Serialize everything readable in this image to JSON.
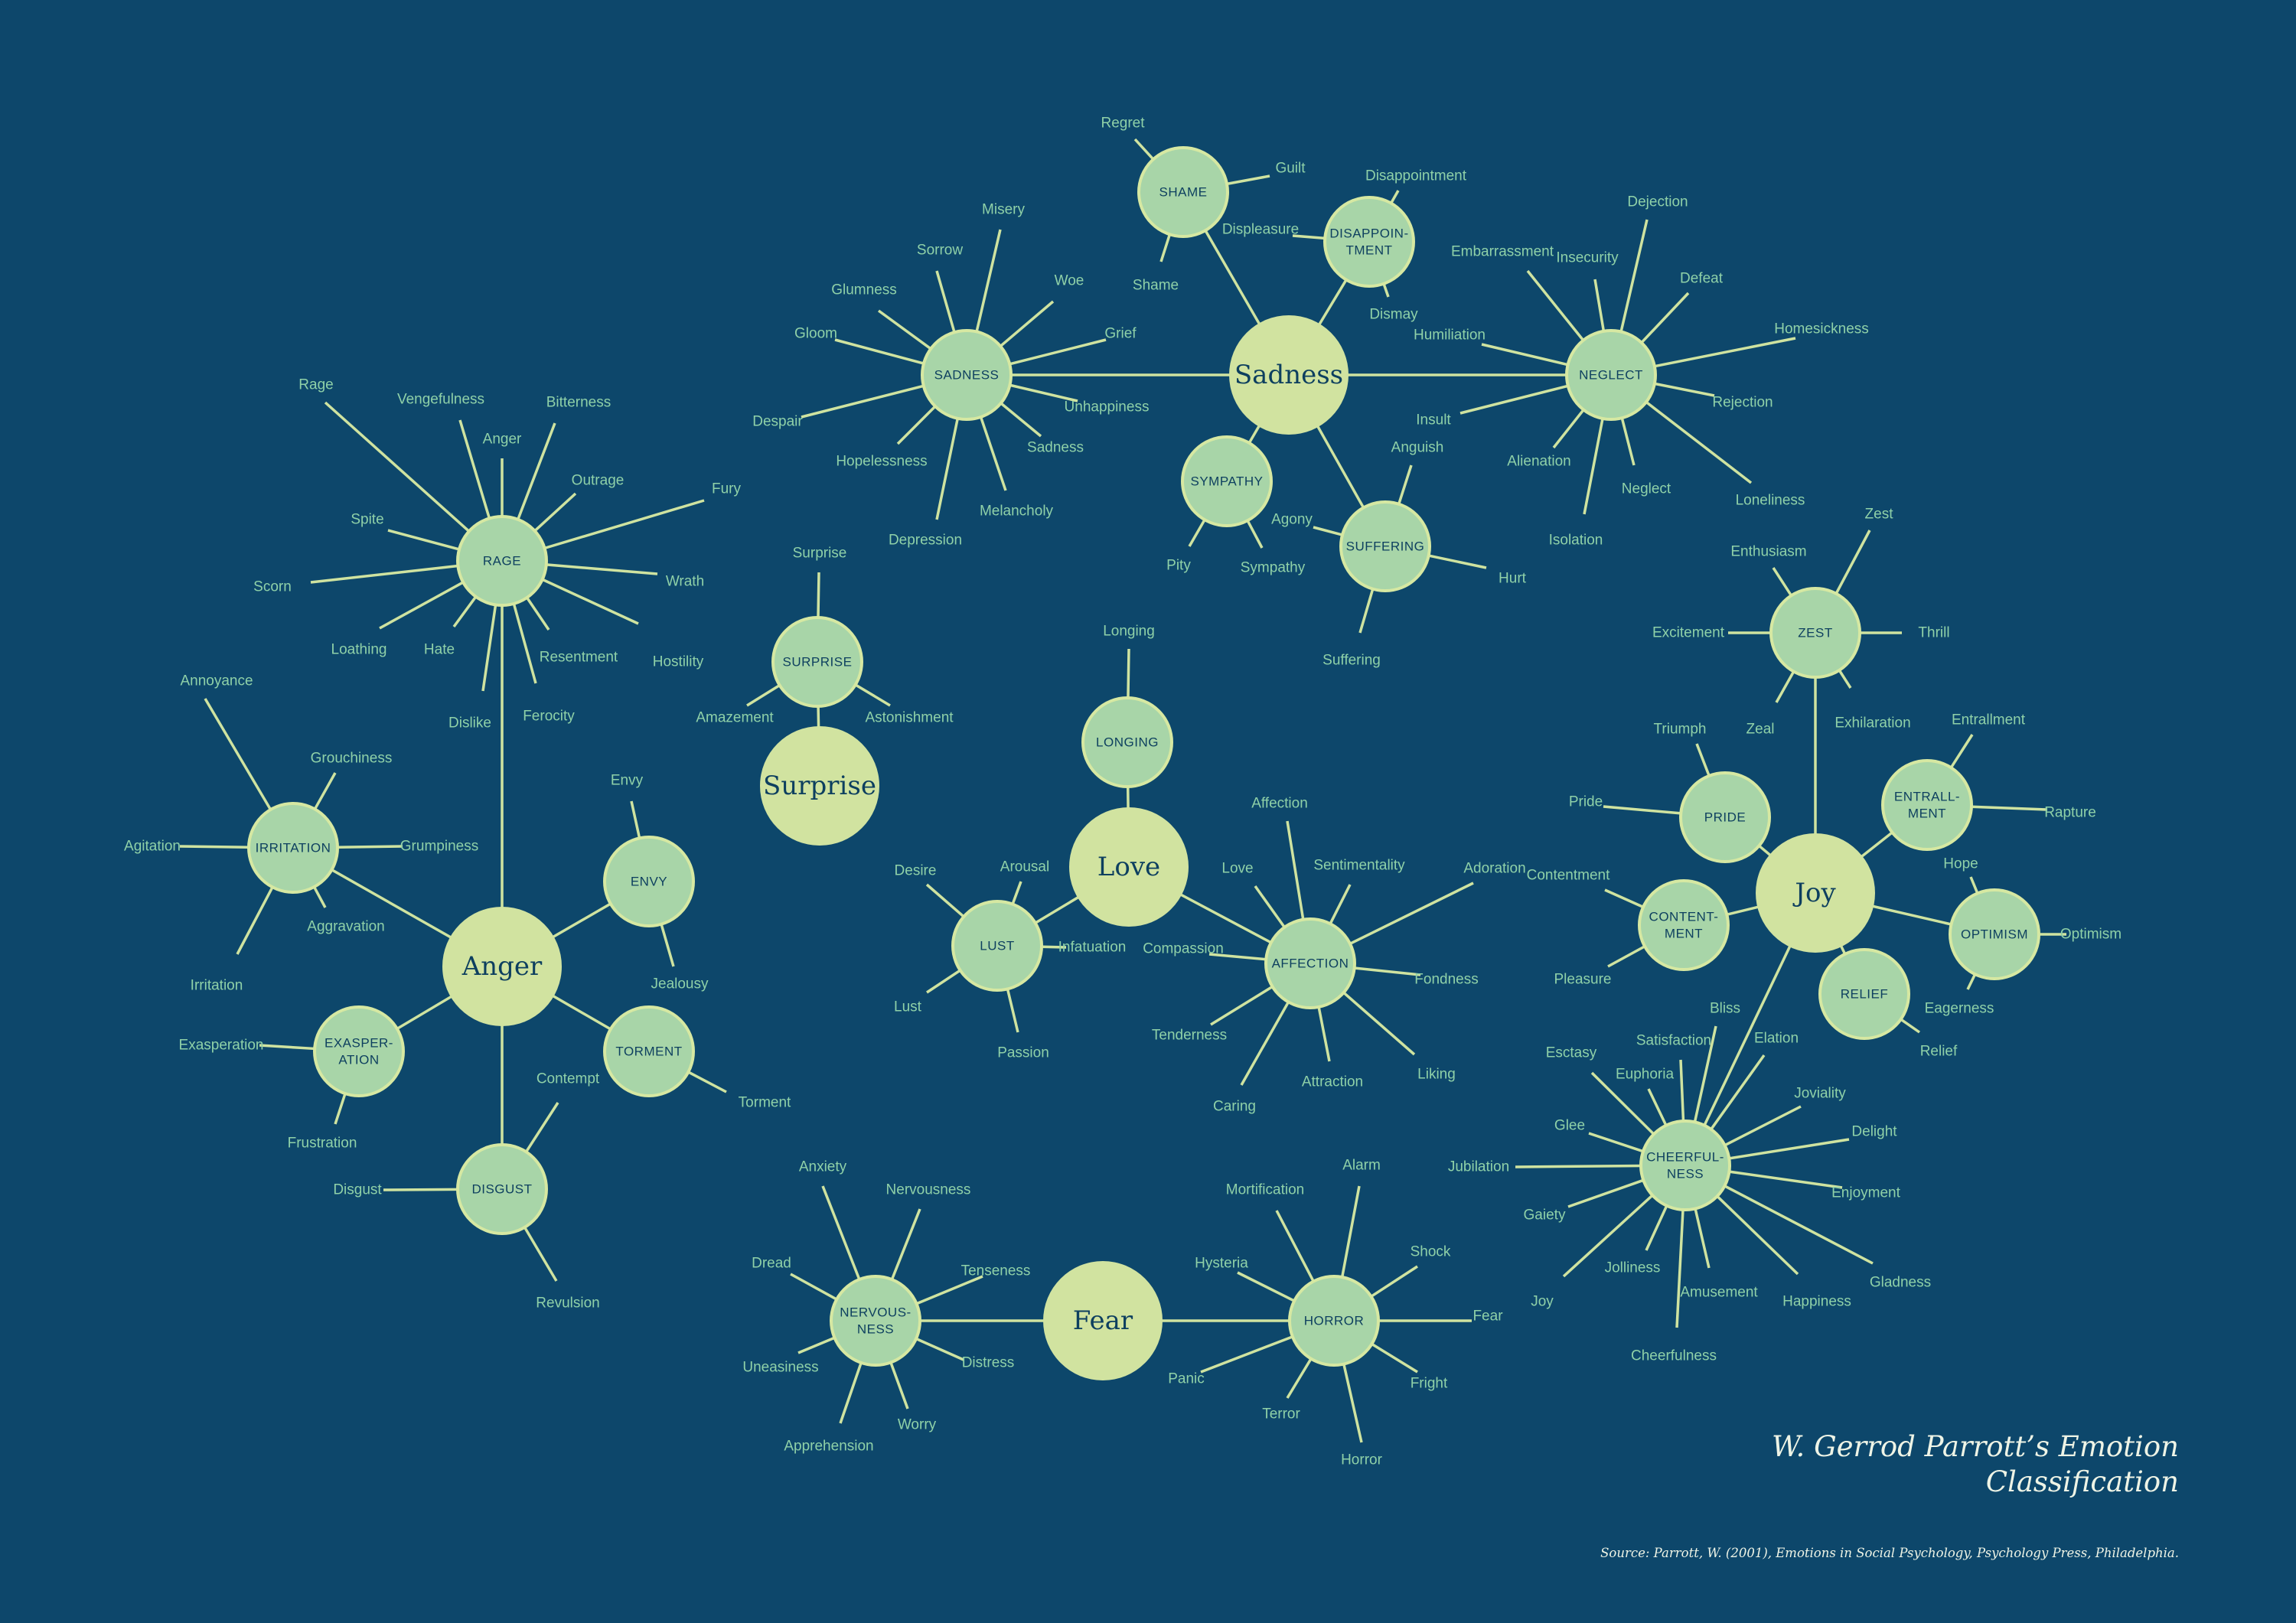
{
  "title": {
    "line1": "W. Gerrod Parrott’s Emotion",
    "line2": "Classification"
  },
  "source": "Source: Parrott, W. (2001), Emotions in Social Psychology, Psychology Press, Philadelphia.",
  "colors": {
    "background": "#0d476b",
    "primary_node": "#d1e3a0",
    "secondary_node": "#a8d5a8",
    "leaf_text": "#8fd1a8",
    "node_text": "#0d3f5f",
    "edge": "#cfe3a0"
  },
  "primary": [
    {
      "id": "anger",
      "label": "Anger"
    },
    {
      "id": "sadness",
      "label": "Sadness"
    },
    {
      "id": "surprise",
      "label": "Surprise"
    },
    {
      "id": "love",
      "label": "Love"
    },
    {
      "id": "fear",
      "label": "Fear"
    },
    {
      "id": "joy",
      "label": "Joy"
    }
  ],
  "secondary": [
    {
      "id": "rage",
      "parent": "anger",
      "label": [
        "RAGE"
      ],
      "leaves": [
        "Rage",
        "Vengefulness",
        "Anger",
        "Bitterness",
        "Outrage",
        "Fury",
        "Spite",
        "Scorn",
        "Wrath",
        "Loathing",
        "Hate",
        "Resentment",
        "Hostility",
        "Dislike",
        "Ferocity"
      ]
    },
    {
      "id": "irritation",
      "parent": "anger",
      "label": [
        "IRRITATION"
      ],
      "leaves": [
        "Annoyance",
        "Grouchiness",
        "Agitation",
        "Grumpiness",
        "Aggravation",
        "Irritation"
      ]
    },
    {
      "id": "envy",
      "parent": "anger",
      "label": [
        "ENVY"
      ],
      "leaves": [
        "Envy",
        "Jealousy"
      ]
    },
    {
      "id": "exasperation",
      "parent": "anger",
      "label": [
        "EXASPER-",
        "ATION"
      ],
      "leaves": [
        "Exasperation",
        "Frustration"
      ]
    },
    {
      "id": "torment",
      "parent": "anger",
      "label": [
        "TORMENT"
      ],
      "leaves": [
        "Torment"
      ]
    },
    {
      "id": "disgust",
      "parent": "anger",
      "label": [
        "DISGUST"
      ],
      "leaves": [
        "Contempt",
        "Disgust",
        "Revulsion"
      ]
    },
    {
      "id": "sadness2",
      "parent": "sadness",
      "label": [
        "SADNESS"
      ],
      "leaves": [
        "Misery",
        "Sorrow",
        "Glumness",
        "Woe",
        "Gloom",
        "Grief",
        "Unhappiness",
        "Despair",
        "Hopelessness",
        "Sadness",
        "Melancholy",
        "Depression"
      ]
    },
    {
      "id": "shame",
      "parent": "sadness",
      "label": [
        "SHAME"
      ],
      "leaves": [
        "Regret",
        "Guilt",
        "Shame"
      ]
    },
    {
      "id": "disappointment",
      "parent": "sadness",
      "label": [
        "DISAPPOIN-",
        "TMENT"
      ],
      "leaves": [
        "Disappointment",
        "Displeasure",
        "Dismay"
      ]
    },
    {
      "id": "sympathy",
      "parent": "sadness",
      "label": [
        "SYMPATHY"
      ],
      "leaves": [
        "Pity",
        "Sympathy"
      ]
    },
    {
      "id": "suffering",
      "parent": "sadness",
      "label": [
        "SUFFERING"
      ],
      "leaves": [
        "Anguish",
        "Agony",
        "Hurt",
        "Suffering"
      ]
    },
    {
      "id": "neglect",
      "parent": "sadness",
      "label": [
        "NEGLECT"
      ],
      "leaves": [
        "Dejection",
        "Embarrassment",
        "Insecurity",
        "Defeat",
        "Homesickness",
        "Humiliation",
        "Rejection",
        "Insult",
        "Alienation",
        "Neglect",
        "Loneliness",
        "Isolation"
      ]
    },
    {
      "id": "surprise2",
      "parent": "surprise",
      "label": [
        "SURPRISE"
      ],
      "leaves": [
        "Surprise",
        "Amazement",
        "Astonishment"
      ]
    },
    {
      "id": "longing",
      "parent": "love",
      "label": [
        "LONGING"
      ],
      "leaves": [
        "Longing"
      ]
    },
    {
      "id": "lust",
      "parent": "love",
      "label": [
        "LUST"
      ],
      "leaves": [
        "Desire",
        "Arousal",
        "Infatuation",
        "Lust",
        "Passion"
      ]
    },
    {
      "id": "affection",
      "parent": "love",
      "label": [
        "AFFECTION"
      ],
      "leaves": [
        "Affection",
        "Sentimentality",
        "Adoration",
        "Love",
        "Compassion",
        "Fondness",
        "Tenderness",
        "Liking",
        "Attraction",
        "Caring"
      ]
    },
    {
      "id": "nervousness",
      "parent": "fear",
      "label": [
        "NERVOUS-",
        "NESS"
      ],
      "leaves": [
        "Anxiety",
        "Nervousness",
        "Tenseness",
        "Dread",
        "Distress",
        "Uneasiness",
        "Worry",
        "Apprehension"
      ]
    },
    {
      "id": "horror",
      "parent": "fear",
      "label": [
        "HORROR"
      ],
      "leaves": [
        "Alarm",
        "Mortification",
        "Hysteria",
        "Shock",
        "Fear",
        "Panic",
        "Fright",
        "Terror",
        "Horror"
      ]
    },
    {
      "id": "zest",
      "parent": "joy",
      "label": [
        "ZEST"
      ],
      "leaves": [
        "Enthusiasm",
        "Zest",
        "Excitement",
        "Thrill",
        "Zeal",
        "Exhilaration"
      ]
    },
    {
      "id": "pride",
      "parent": "joy",
      "label": [
        "PRIDE"
      ],
      "leaves": [
        "Triumph",
        "Pride"
      ]
    },
    {
      "id": "entrallment",
      "parent": "joy",
      "label": [
        "ENTRALL-",
        "MENT"
      ],
      "leaves": [
        "Entrallment",
        "Rapture"
      ]
    },
    {
      "id": "contentment",
      "parent": "joy",
      "label": [
        "CONTENT-",
        "MENT"
      ],
      "leaves": [
        "Contentment",
        "Pleasure"
      ]
    },
    {
      "id": "optimism",
      "parent": "joy",
      "label": [
        "OPTIMISM"
      ],
      "leaves": [
        "Hope",
        "Optimism",
        "Eagerness"
      ]
    },
    {
      "id": "relief",
      "parent": "joy",
      "label": [
        "RELIEF"
      ],
      "leaves": [
        "Relief"
      ]
    },
    {
      "id": "cheerfulness",
      "parent": "joy",
      "label": [
        "CHEERFUL-",
        "NESS"
      ],
      "leaves": [
        "Bliss",
        "Satisfaction",
        "Elation",
        "Esctasy",
        "Euphoria",
        "Joviality",
        "Glee",
        "Delight",
        "Jubilation",
        "Enjoyment",
        "Gaiety",
        "Jolliness",
        "Joy",
        "Amusement",
        "Happiness",
        "Gladness",
        "Cheerfulness"
      ]
    }
  ]
}
